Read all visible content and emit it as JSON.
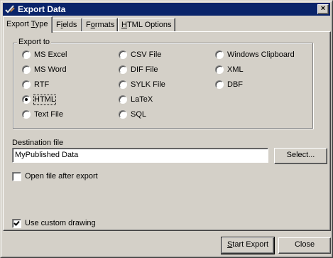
{
  "window": {
    "title": "Export Data",
    "app_icon": "checkmark-pencil-icon",
    "close_icon": "close-icon",
    "close_label": "×"
  },
  "tabs": [
    {
      "pre": "Export ",
      "key": "T",
      "post": "ype",
      "active": true
    },
    {
      "pre": "F",
      "key": "i",
      "post": "elds",
      "active": false
    },
    {
      "pre": "F",
      "key": "o",
      "post": "rmats",
      "active": false
    },
    {
      "pre": "",
      "key": "H",
      "post": "TML Options",
      "active": false
    }
  ],
  "export_to": {
    "label": "Export to",
    "selected": "HTML",
    "options": [
      {
        "label": "MS Excel"
      },
      {
        "label": "MS Word"
      },
      {
        "label": "RTF"
      },
      {
        "label": "HTML"
      },
      {
        "label": "Text File"
      },
      {
        "label": "CSV File"
      },
      {
        "label": "DIF File"
      },
      {
        "label": "SYLK File"
      },
      {
        "label": "LaTeX"
      },
      {
        "label": "SQL"
      },
      {
        "label": "Windows Clipboard"
      },
      {
        "label": "XML"
      },
      {
        "label": "DBF"
      }
    ]
  },
  "destination": {
    "label": "Destination file",
    "value": "MyPublished Data",
    "select_button": "Select..."
  },
  "open_after_export": {
    "label": "Open file after export",
    "checked": false
  },
  "custom_drawing": {
    "label": "Use custom drawing",
    "checked": true
  },
  "footer": {
    "start_export": {
      "pre": "",
      "key": "S",
      "post": "tart Export"
    },
    "close": "Close"
  }
}
